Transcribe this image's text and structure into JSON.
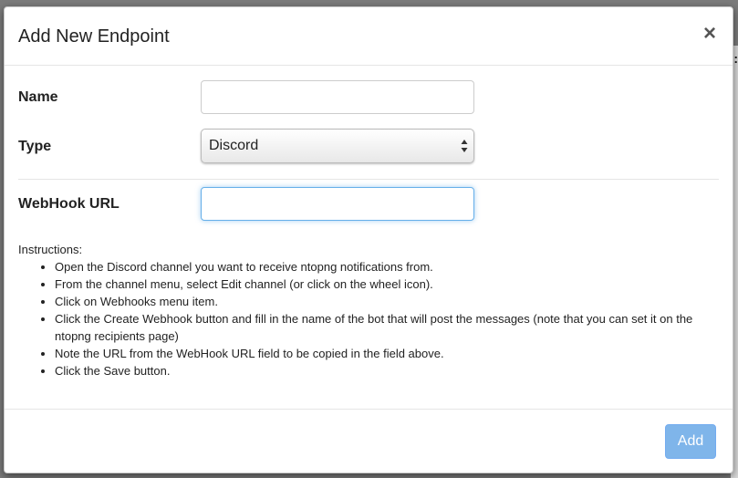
{
  "backdrop": {
    "colon": ":"
  },
  "modal": {
    "title": "Add New Endpoint",
    "close_glyph": "×",
    "fields": {
      "name_label": "Name",
      "name_value": "",
      "type_label": "Type",
      "type_value": "Discord",
      "webhook_label": "WebHook URL",
      "webhook_value": ""
    },
    "instructions": {
      "heading": "Instructions:",
      "steps": [
        "Open the Discord channel you want to receive ntopng notifications from.",
        "From the channel menu, select Edit channel (or click on the wheel icon).",
        "Click on Webhooks menu item.",
        "Click the Create Webhook button and fill in the name of the bot that will post the messages (note that you can set it on the ntopng recipients page)",
        "Note the URL from the WebHook URL field to be copied in the field above.",
        "Click the Save button."
      ]
    },
    "footer": {
      "add_label": "Add"
    }
  },
  "colors": {
    "add_button": "#7fb5ea",
    "focus_border": "#66afe9",
    "backdrop": "#7b7b7b"
  },
  "icons": {
    "close": "close-icon",
    "select_arrows": "chevron-up-down-icon"
  }
}
